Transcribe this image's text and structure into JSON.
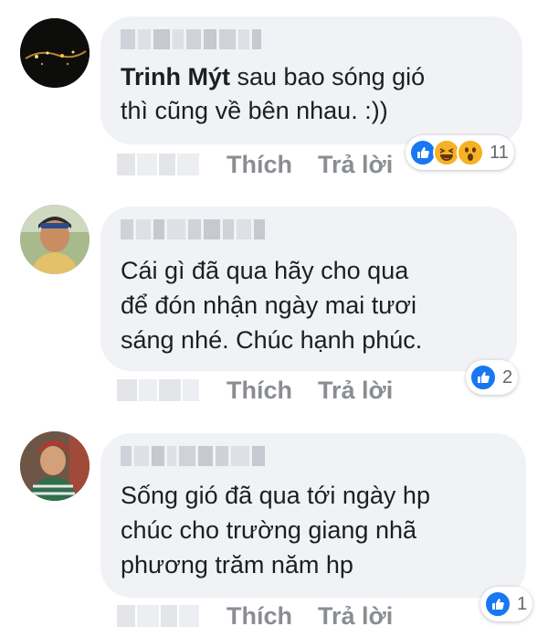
{
  "comments": [
    {
      "author": "Trinh Mýt",
      "text_first": "sau bao sóng gió",
      "text_lines": [
        "thì cũng về bên nhau. :))"
      ],
      "actions": {
        "like": "Thích",
        "reply": "Trả lời"
      },
      "reactions": {
        "icons": [
          "like-icon",
          "haha-icon",
          "wow-icon"
        ],
        "count": "11"
      }
    },
    {
      "text_lines": [
        "Cái gì đã qua hãy cho qua",
        "để đón nhận ngày mai tươi",
        "sáng nhé. Chúc hạnh phúc."
      ],
      "actions": {
        "like": "Thích",
        "reply": "Trả lời"
      },
      "reactions": {
        "icons": [
          "like-icon"
        ],
        "count": "2"
      }
    },
    {
      "text_lines": [
        "Sống gió đã qua tới ngày hp",
        "chúc cho trường giang nhã",
        "phương trăm năm hp"
      ],
      "actions": {
        "like": "Thích",
        "reply": "Trả lời"
      },
      "reactions": {
        "icons": [
          "like-icon"
        ],
        "count": "1"
      }
    }
  ],
  "colors": {
    "bubble": "#f0f2f5",
    "action_text": "#8a8d91",
    "like_blue": "#1877f2",
    "emoji_yellow": "#f7b125"
  }
}
